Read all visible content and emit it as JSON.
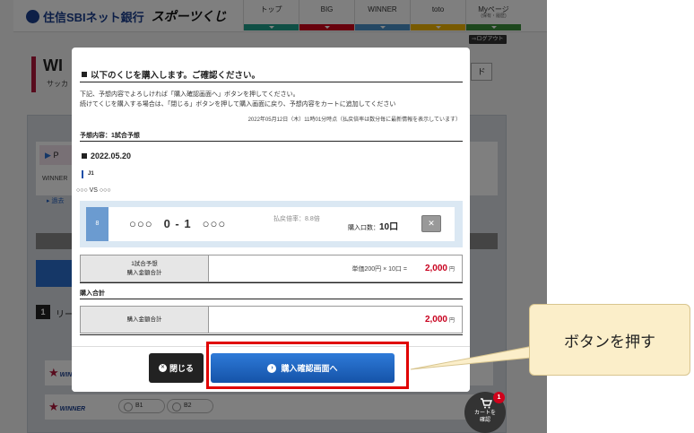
{
  "header": {
    "bank_name": "住信SBIネット銀行",
    "brand": "スポーツくじ",
    "nav": [
      {
        "label": "トップ",
        "sub": "",
        "color": "#1f9e8a"
      },
      {
        "label": "BIG",
        "sub": "",
        "color": "#d0021b"
      },
      {
        "label": "WINNER",
        "sub": "",
        "color": "#4a90c8"
      },
      {
        "label": "toto",
        "sub": "",
        "color": "#f0b400"
      },
      {
        "label": "Myページ",
        "sub": "(保有・履歴)",
        "color": "#3a8f3a"
      }
    ],
    "logout": "ログアウト"
  },
  "background": {
    "page_title": "WI",
    "page_subtitle": "サッカ",
    "button": "ド",
    "p1": "P",
    "winner_text": "WINNER",
    "link": "過去",
    "section_number": "1",
    "section_label": "リー",
    "winner_logo": "WINNER",
    "winner_logo_sub": "BASKETBALL",
    "options": [
      "B1",
      "B2"
    ]
  },
  "modal": {
    "title": "以下のくじを購入します。ご確認ください。",
    "desc_line1": "下記、予想内容でよろしければ「購入確認画面へ」ボタンを押してください。",
    "desc_line2": "続けてくじを購入する場合は、「閉じる」ボタンを押して購入画面に戻り、予想内容をカートに追加してください",
    "timestamp": "2022年05月12日（木）11時01分時点（払戻倍率は数分毎に最新情報を表示しています）",
    "prediction_header": "予想内容：1試合予想",
    "date": "2022.05.20",
    "league": "J1",
    "teams": "○○○ VS ○○○",
    "bet": {
      "number": "8",
      "home": "○○○",
      "score_home": "0",
      "dash": "-",
      "score_away": "1",
      "away": "○○○",
      "payout_label": "払戻倍率：8.8倍",
      "count_label": "購入口数：",
      "count_value": "10口",
      "remove": "✕"
    },
    "subtotal": {
      "label_line1": "1試合予想",
      "label_line2": "購入金額合計",
      "calc": "単価200円 × 10口 =",
      "amount": "2,000",
      "unit": "円"
    },
    "total_header": "購入合計",
    "total": {
      "label": "購入金額合計",
      "amount": "2,000",
      "unit": "円"
    },
    "close_button": "閉じる",
    "confirm_button": "購入確認画面へ"
  },
  "callout": {
    "text": "ボタンを押す"
  },
  "cart": {
    "badge": "1",
    "label_line1": "カートを",
    "label_line2": "確認"
  },
  "colors": {
    "primary_blue": "#1553a8",
    "highlight_red": "#e00000",
    "amount_red": "#c8001e",
    "callout_bg": "#fbeec9"
  }
}
